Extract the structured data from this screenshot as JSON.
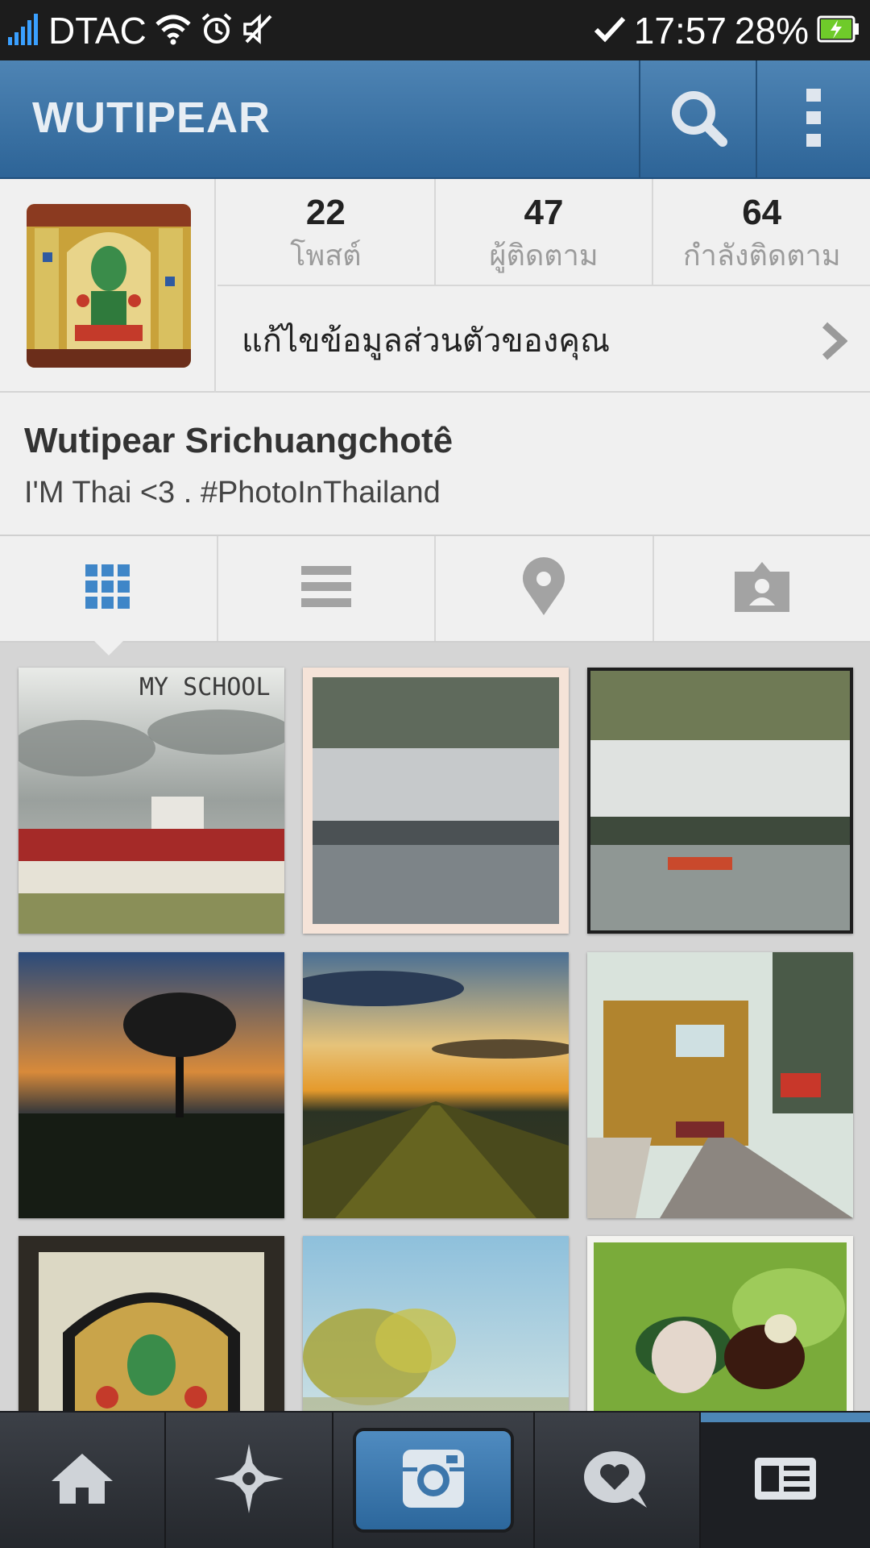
{
  "status_bar": {
    "carrier": "DTAC",
    "time": "17:57",
    "battery_percent": "28%"
  },
  "action_bar": {
    "title": "WUTIPEAR",
    "search_icon": "search-icon",
    "overflow_icon": "overflow-menu-icon"
  },
  "profile": {
    "stats": [
      {
        "count": "22",
        "label": "โพสต์"
      },
      {
        "count": "47",
        "label": "ผู้ติดตาม"
      },
      {
        "count": "64",
        "label": "กำลังติดตาม"
      }
    ],
    "edit_profile_label": "แก้ไขข้อมูลส่วนตัวของคุณ"
  },
  "bio": {
    "full_name": "Wutipear Srichuangchotê",
    "text": "I'M Thai <3 .  #PhotoInThailand"
  },
  "tabs": [
    {
      "name": "grid-view-tab",
      "icon": "grid-icon",
      "active": true
    },
    {
      "name": "list-view-tab",
      "icon": "list-icon",
      "active": false
    },
    {
      "name": "photo-map-tab",
      "icon": "location-pin-icon",
      "active": false
    },
    {
      "name": "photos-of-you-tab",
      "icon": "person-tag-icon",
      "active": false
    }
  ],
  "photos": [
    {
      "caption_overlay": "MY SCHOOL",
      "subject": "school buildings under cloudy sky"
    },
    {
      "caption_overlay": "",
      "subject": "river view under awning"
    },
    {
      "caption_overlay": "",
      "subject": "river with boat under awning"
    },
    {
      "caption_overlay": "",
      "subject": "tree silhouette at sunset"
    },
    {
      "caption_overlay": "",
      "subject": "field rows at sunset"
    },
    {
      "caption_overlay": "",
      "subject": "train on tracks"
    },
    {
      "caption_overlay": "",
      "subject": "decorative arched artwork"
    },
    {
      "caption_overlay": "",
      "subject": "blurred tree and sky"
    },
    {
      "caption_overlay": "",
      "subject": "food on lettuce"
    }
  ],
  "bottom_nav": [
    {
      "name": "nav-home",
      "icon": "home-icon"
    },
    {
      "name": "nav-explore",
      "icon": "explore-star-icon"
    },
    {
      "name": "nav-camera",
      "icon": "camera-icon"
    },
    {
      "name": "nav-news",
      "icon": "activity-heart-icon"
    },
    {
      "name": "nav-profile",
      "icon": "profile-card-icon",
      "active": true
    }
  ],
  "colors": {
    "accent_blue": "#2d6497",
    "background": "#f0f0f0",
    "nav_dark": "#25282d"
  }
}
